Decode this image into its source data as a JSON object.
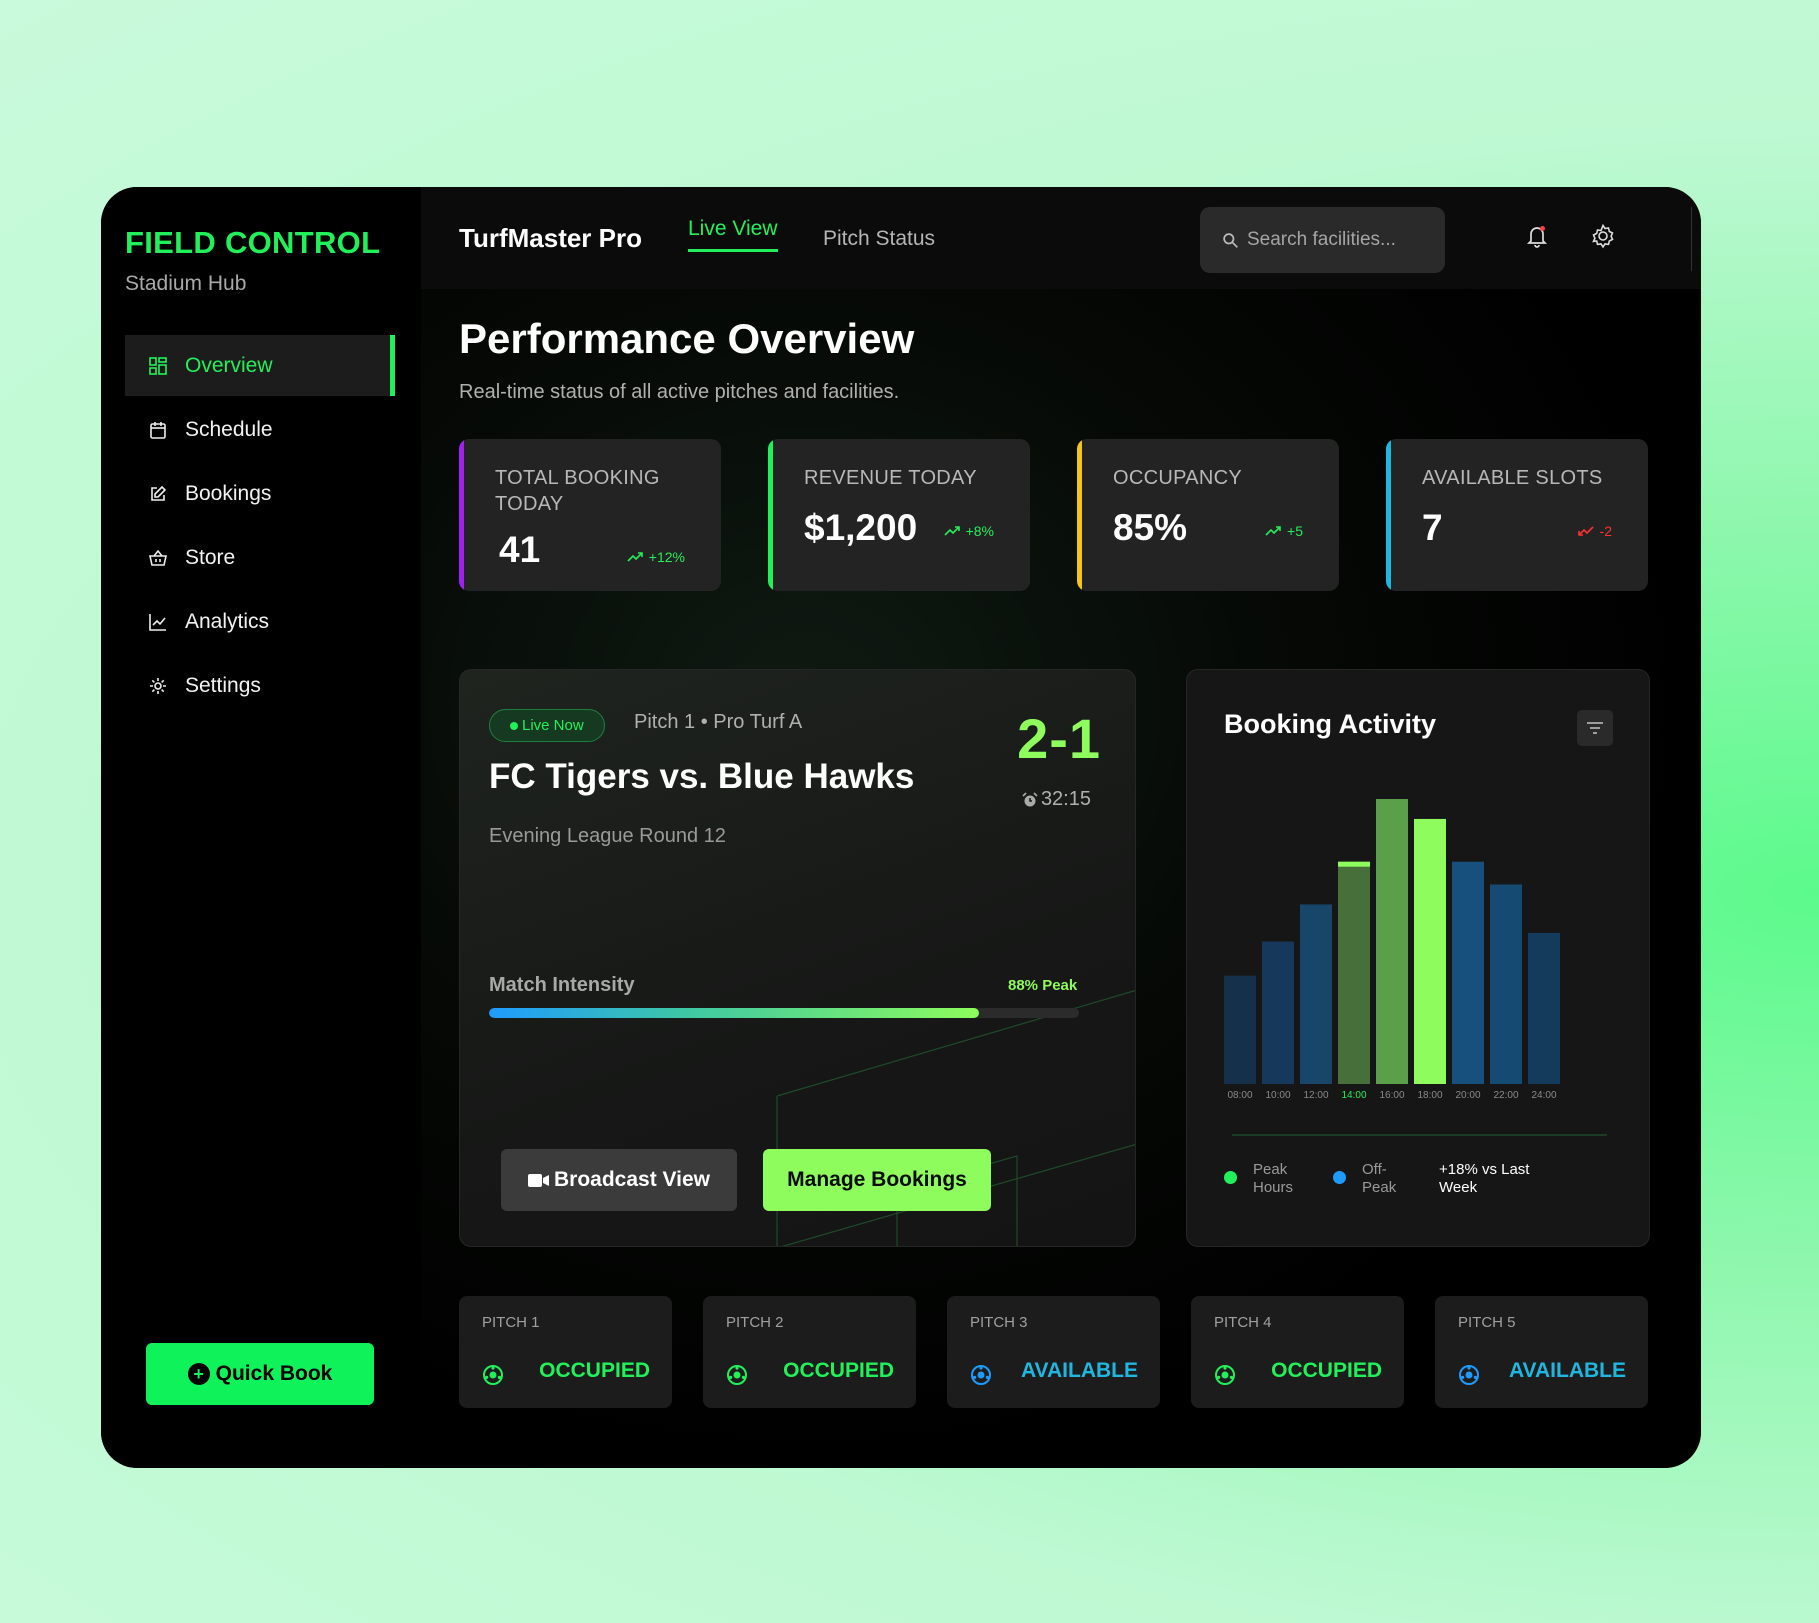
{
  "sidebar": {
    "brand": "FIELD CONTROL",
    "brand_sub": "Stadium Hub",
    "items": [
      {
        "label": "Overview",
        "icon": "grid-icon",
        "active": true
      },
      {
        "label": "Schedule",
        "icon": "calendar-icon"
      },
      {
        "label": "Bookings",
        "icon": "edit-icon"
      },
      {
        "label": "Store",
        "icon": "basket-icon"
      },
      {
        "label": "Analytics",
        "icon": "chart-line-icon"
      },
      {
        "label": "Settings",
        "icon": "gear-icon"
      }
    ],
    "quick_book": "Quick Book"
  },
  "header": {
    "app_title": "TurfMaster Pro",
    "tabs": [
      {
        "label": "Live View",
        "active": true
      },
      {
        "label": "Pitch Status"
      }
    ],
    "search_placeholder": "Search facilities..."
  },
  "main": {
    "title": "Performance Overview",
    "subtitle": "Real-time status of all active pitches and facilities.",
    "stats": [
      {
        "label": "TOTAL BOOKING TODAY",
        "value": "41",
        "delta": "+12%",
        "trend": "up",
        "accent": "#a020f0"
      },
      {
        "label": "REVENUE TODAY",
        "value": "$1,200",
        "delta": "+8%",
        "trend": "up",
        "accent": "#22f05a"
      },
      {
        "label": "OCCUPENCY",
        "value": "85%",
        "delta": "+5",
        "trend": "up",
        "accent": "#f5c518"
      },
      {
        "label": "AVAILABLE SLOTS",
        "value": "7",
        "delta": "-2",
        "trend": "down",
        "accent": "#1fb6e0"
      }
    ],
    "live": {
      "badge": "Live Now",
      "pitch": "Pitch 1 • Pro Turf A",
      "title": "FC Tigers vs. Blue Hawks",
      "score": "2-1",
      "time": "32:15",
      "round": "Evening League Round 12",
      "intensity_label": "Match Intensity",
      "intensity_value": "88% Peak",
      "intensity_fraction": 0.83,
      "broadcast_label": "Broadcast View",
      "manage_label": "Manage Bookings"
    },
    "activity": {
      "title": "Booking Activity",
      "legend": [
        {
          "label": "Peak Hours",
          "color": "#22f05a"
        },
        {
          "label": "Off-Peak",
          "color": "#1e9bff"
        }
      ],
      "compare": "+18% vs Last Week"
    },
    "pitches": [
      {
        "name": "PITCH 1",
        "status": "OCCUPIED",
        "color": "#22f05a"
      },
      {
        "name": "PITCH 2",
        "status": "OCCUPIED",
        "color": "#22f05a"
      },
      {
        "name": "PITCH 3",
        "status": "AVAILABLE",
        "color": "#1fb6e0"
      },
      {
        "name": "PITCH 4",
        "status": "OCCUPIED",
        "color": "#22f05a"
      },
      {
        "name": "PITCH 5",
        "status": "AVAILABLE",
        "color": "#1fb6e0"
      }
    ]
  },
  "chart_data": {
    "type": "bar",
    "categories": [
      "08:00",
      "10:00",
      "12:00",
      "14:00",
      "16:00",
      "18:00",
      "20:00",
      "22:00",
      "24:00"
    ],
    "values": [
      38,
      50,
      63,
      78,
      100,
      93,
      78,
      70,
      53
    ],
    "highlight": "14:00",
    "ylim": [
      0,
      100
    ]
  }
}
